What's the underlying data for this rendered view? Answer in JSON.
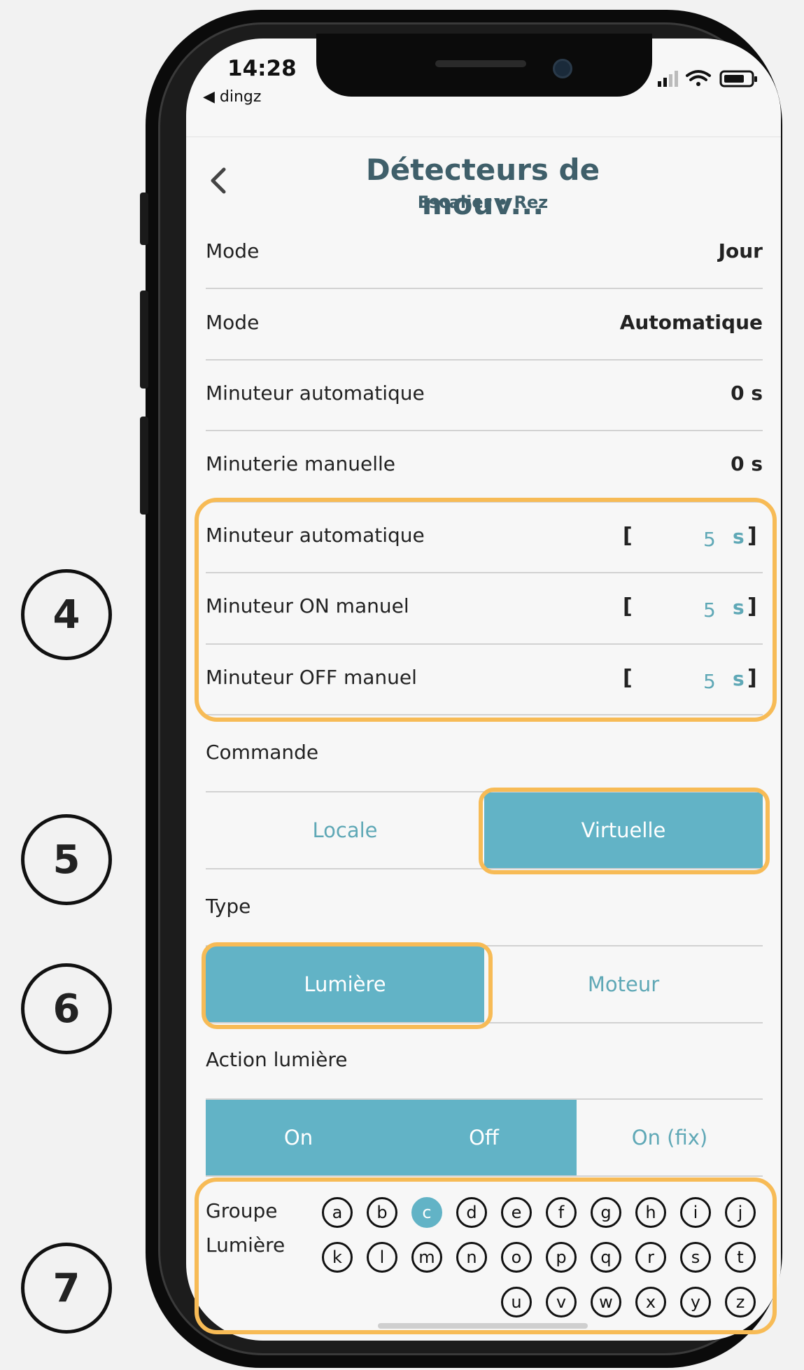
{
  "status_bar": {
    "time": "14:28",
    "back_app": "◀ dingz"
  },
  "header": {
    "title": "Détecteurs de mouv...",
    "subtitle": "Escalier • Rez"
  },
  "settings": [
    {
      "label": "Mode",
      "value": "Jour"
    },
    {
      "label": "Mode",
      "value": "Automatique"
    },
    {
      "label": "Minuteur automatique",
      "value": "0 s"
    },
    {
      "label": "Minuterie manuelle",
      "value": "0 s"
    }
  ],
  "timers": [
    {
      "label": "Minuteur automatique",
      "value": "5",
      "unit": "s"
    },
    {
      "label": "Minuteur ON manuel",
      "value": "5",
      "unit": "s"
    },
    {
      "label": "Minuteur OFF manuel",
      "value": "5",
      "unit": "s"
    }
  ],
  "brackets": {
    "open": "[",
    "close": "]"
  },
  "commande": {
    "label": "Commande",
    "options": [
      "Locale",
      "Virtuelle"
    ],
    "selected": "Virtuelle"
  },
  "type": {
    "label": "Type",
    "options": [
      "Lumière",
      "Moteur"
    ],
    "selected": "Lumière"
  },
  "action": {
    "label": "Action lumière",
    "options": [
      "On",
      "Off",
      "On (fix)"
    ],
    "selected": [
      "On",
      "Off"
    ]
  },
  "groupe": {
    "label_line1": "Groupe",
    "label_line2": "Lumière",
    "letters": [
      "a",
      "b",
      "c",
      "d",
      "e",
      "f",
      "g",
      "h",
      "i",
      "j",
      "k",
      "l",
      "m",
      "n",
      "o",
      "p",
      "q",
      "r",
      "s",
      "t",
      "u",
      "v",
      "w",
      "x",
      "y",
      "z"
    ],
    "selected": "c"
  },
  "callouts": [
    "4",
    "5",
    "6",
    "7"
  ],
  "colors": {
    "accent": "#62b3c6",
    "highlight": "#f7bb56",
    "title": "#3f5f6a"
  }
}
